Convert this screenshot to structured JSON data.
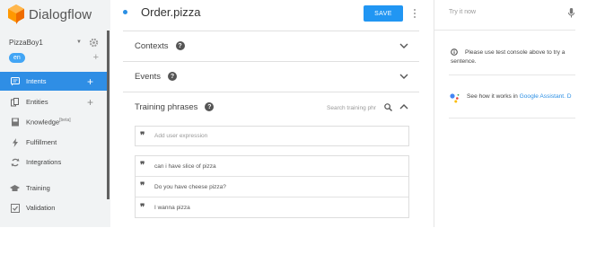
{
  "app": {
    "name": "Dialogflow"
  },
  "agent": {
    "name": "PizzaBoy1",
    "language": "en"
  },
  "nav": [
    {
      "label": "Intents",
      "icon": "chat-icon",
      "plus": "+"
    },
    {
      "label": "Entities",
      "icon": "entities-icon",
      "plus": "+"
    },
    {
      "label": "Knowledge",
      "badge": "[beta]",
      "icon": "book-icon"
    },
    {
      "label": "Fulfillment",
      "icon": "bolt-icon"
    },
    {
      "label": "Integrations",
      "icon": "integrations-icon"
    },
    {
      "label": "Training",
      "icon": "graduation-cap-icon"
    },
    {
      "label": "Validation",
      "icon": "checkbox-icon"
    }
  ],
  "intent": {
    "title": "Order.pizza",
    "save_label": "SAVE"
  },
  "sections": {
    "contexts": "Contexts",
    "events": "Events",
    "training": "Training phrases"
  },
  "training": {
    "search_placeholder": "Search training phr",
    "add_placeholder": "Add user expression",
    "phrases": [
      "can i have slice of pizza",
      "Do you have cheese pizza?",
      "I wanna pizza"
    ]
  },
  "console": {
    "try_placeholder": "Try it now",
    "note": "Please use test console above to try a sentence.",
    "ga_text": "See how it works in ",
    "ga_link": "Google Assistant. D"
  },
  "colors": {
    "accent": "#2196f3",
    "active_nav": "#2f8ee5",
    "sidebar_bg": "#f1f3f4"
  }
}
